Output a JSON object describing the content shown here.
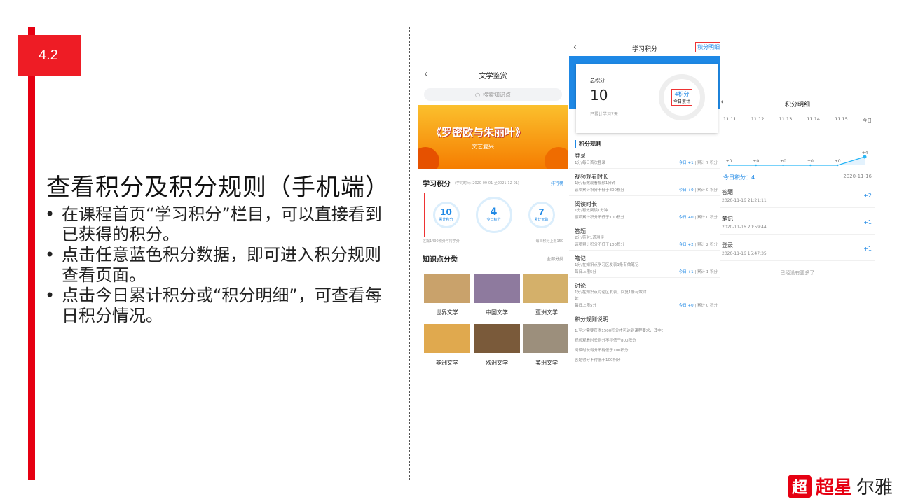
{
  "badge": "4.2",
  "title": "查看积分及积分规则（手机端）",
  "bullets": [
    "在课程首页“学习积分”栏目，可以直接看到已获得的积分。",
    "点击任意蓝色积分数据，即可进入积分规则查看页面。",
    "点击今日累计积分或“积分明细”，可查看每日积分情况。"
  ],
  "phone1": {
    "title": "文学鉴赏",
    "search_placeholder": "搜索知识点",
    "banner_title": "《罗密欧与朱丽叶》",
    "banner_sub": "文艺复兴",
    "section_title": "学习积分",
    "section_sub": "(学习时间: 2020-09-01 至2021-12-01)",
    "rank_label": "排行榜",
    "stats": [
      {
        "value": "10",
        "label": "累计积分"
      },
      {
        "value": "4",
        "label": "今日积分"
      },
      {
        "value": "7",
        "label": "累计天数"
      }
    ],
    "foot_left": "还需1490积分可得学分",
    "foot_right": "每日积分上限150",
    "cat_title": "知识点分类",
    "cat_all": "全部分类",
    "categories": [
      "世界文学",
      "中国文学",
      "亚洲文学",
      "非洲文学",
      "欧洲文学",
      "美洲文学"
    ],
    "category_colors": [
      "#c9a26b",
      "#8e7a9e",
      "#d4b06a",
      "#e0a94e",
      "#7a5a3a",
      "#9c8f7c"
    ]
  },
  "phone2": {
    "title": "学习积分",
    "detail_link": "积分明细",
    "total_label": "总积分",
    "total_value": "10",
    "days_note": "已累计学习7天",
    "gauge_value": "4积分",
    "gauge_label": "今日累计",
    "rules_title": "积分规则",
    "rules": [
      {
        "name": "登录",
        "desc": [
          "1分/每日首次登录"
        ],
        "today": "今日 +1",
        "total": "累计 7 积分"
      },
      {
        "name": "视频观看时长",
        "desc": [
          "1分/有效观看视频1分钟",
          "该项累计积分不低于800积分"
        ],
        "today": "今日 +0",
        "total": "累计 0 积分"
      },
      {
        "name": "阅读时长",
        "desc": [
          "1分/有效阅读1分钟",
          "该项累计积分不低于100积分"
        ],
        "today": "今日 +0",
        "total": "累计 0 积分"
      },
      {
        "name": "答题",
        "desc": [
          "2分/答对1道测评",
          "该项累计积分不低于100积分"
        ],
        "today": "今日 +2",
        "total": "累计 2 积分"
      },
      {
        "name": "笔记",
        "desc": [
          "1分/在知识点学习区发表1条有效笔记",
          "每日上限5分"
        ],
        "today": "今日 +1",
        "total": "累计 1 积分"
      },
      {
        "name": "讨论",
        "desc": [
          "1分/在知识点讨论区发表、回复1条有效讨",
          "论",
          "每日上限5分"
        ],
        "today": "今日 +0",
        "total": "累计 0 积分"
      }
    ],
    "explain_title": "积分规则说明",
    "explain_lines": [
      "1.至少需要获得1500积分才可达到课程要求，其中：",
      "视频观看时长得分不得低于800积分",
      "阅读时长得分不得低于100积分",
      "答题得分不得低于100积分"
    ]
  },
  "phone3": {
    "title": "积分明细",
    "dates": [
      "11.11",
      "11.12",
      "11.13",
      "11.14",
      "11.15",
      "今日"
    ],
    "chart_data": {
      "type": "line",
      "x": [
        "11.11",
        "11.12",
        "11.13",
        "11.14",
        "11.15",
        "今日"
      ],
      "values": [
        0,
        0,
        0,
        0,
        0,
        4
      ],
      "labels": [
        "+0",
        "+0",
        "+0",
        "+0",
        "+0",
        "+4"
      ]
    },
    "today_label": "今日积分：4",
    "today_date": "2020-11-16",
    "items": [
      {
        "name": "答题",
        "time": "2020-11-16 21:21:11",
        "value": "+2"
      },
      {
        "name": "笔记",
        "time": "2020-11-16 20:59:44",
        "value": "+1"
      },
      {
        "name": "登录",
        "time": "2020-11-16 15:47:35",
        "value": "+1"
      }
    ],
    "end_text": "已经没有更多了"
  },
  "logo": {
    "mark": "超",
    "brand": "超星",
    "name": "尔雅"
  }
}
